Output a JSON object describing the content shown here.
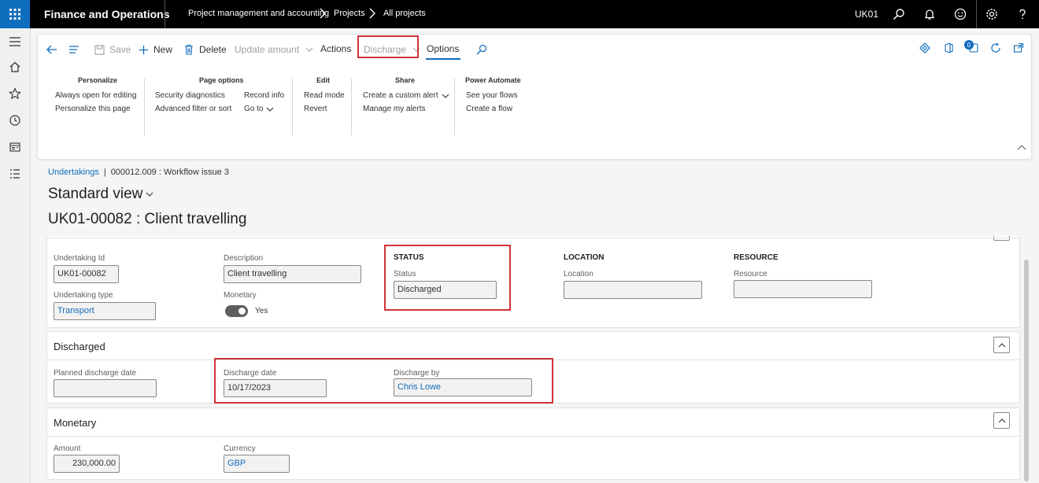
{
  "topbar": {
    "app_title": "Finance and Operations",
    "breadcrumb": [
      "Project management and accounting",
      "Projects",
      "All projects"
    ],
    "company": "UK01"
  },
  "actionpane": {
    "back": "Back",
    "save": "Save",
    "new": "New",
    "delete": "Delete",
    "update_amount": "Update amount",
    "actions": "Actions",
    "discharge": "Discharge",
    "options": "Options",
    "notification_count": "0",
    "groups": {
      "personalize": {
        "title": "Personalize",
        "items": [
          "Always open for editing",
          "Personalize this page"
        ]
      },
      "page_options": {
        "title": "Page options",
        "items": [
          "Security diagnostics",
          "Advanced filter or sort",
          "Record info",
          "Go to"
        ]
      },
      "edit": {
        "title": "Edit",
        "items": [
          "Read mode",
          "Revert"
        ]
      },
      "share": {
        "title": "Share",
        "items": [
          "Create a custom alert",
          "Manage my alerts"
        ]
      },
      "power_automate": {
        "title": "Power Automate",
        "items": [
          "See your flows",
          "Create a flow"
        ]
      }
    }
  },
  "page": {
    "breadcrumb_link": "Undertakings",
    "breadcrumb_sep": "|",
    "breadcrumb_record": "000012.009 : Workflow issue 3",
    "view_name": "Standard view",
    "record_title": "UK01-00082 : Client travelling"
  },
  "general": {
    "undertaking_id_label": "Undertaking Id",
    "undertaking_id": "UK01-00082",
    "description_label": "Description",
    "description": "Client travelling",
    "undertaking_type_label": "Undertaking type",
    "undertaking_type": "Transport",
    "monetary_label": "Monetary",
    "monetary_value": "Yes",
    "status_section": "STATUS",
    "status_label": "Status",
    "status": "Discharged",
    "location_section": "LOCATION",
    "location_label": "Location",
    "location": "",
    "resource_section": "RESOURCE",
    "resource_label": "Resource",
    "resource": ""
  },
  "discharged": {
    "title": "Discharged",
    "planned_label": "Planned discharge date",
    "planned": "",
    "date_label": "Discharge date",
    "date": "10/17/2023",
    "by_label": "Discharge by",
    "by": "Chris Lowe"
  },
  "monetary": {
    "title": "Monetary",
    "amount_label": "Amount",
    "amount": "230,000.00",
    "currency_label": "Currency",
    "currency": "GBP"
  },
  "colors": {
    "accent": "#0f6cbd",
    "highlight": "#d13438",
    "topbar": "#000000"
  }
}
